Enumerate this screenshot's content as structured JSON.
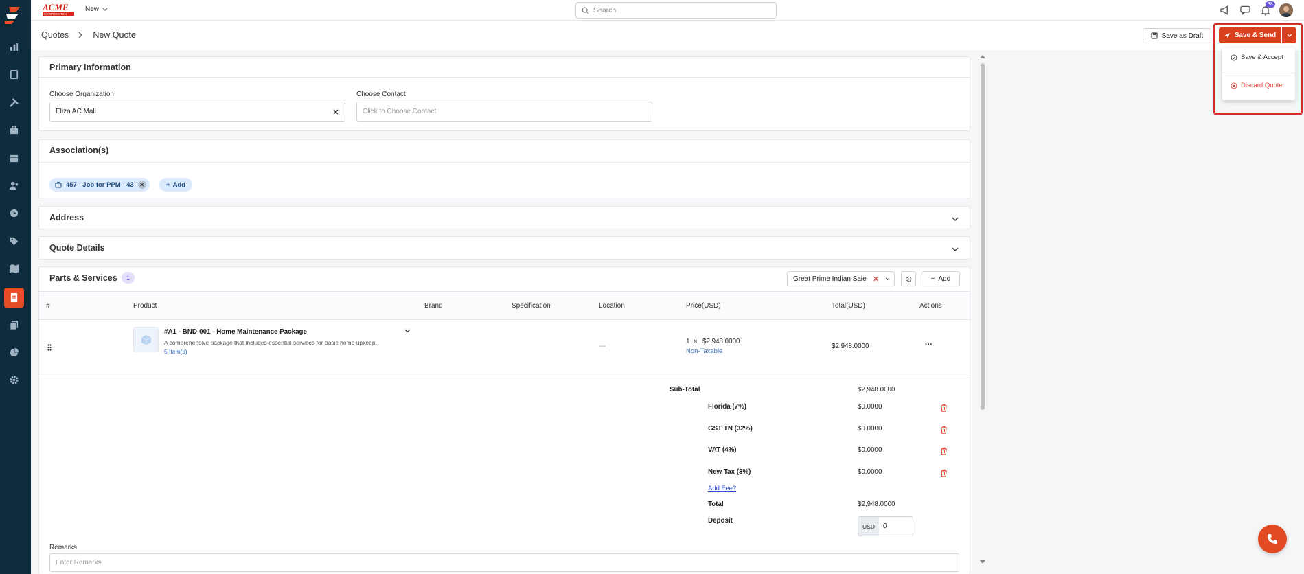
{
  "topbar": {
    "new_label": "New",
    "search_placeholder": "Search",
    "notif_count": "38"
  },
  "breadcrumb": {
    "root": "Quotes",
    "current": "New Quote"
  },
  "actions": {
    "save_draft": "Save as Draft",
    "save_send": "Save & Send",
    "save_accept": "Save & Accept",
    "discard": "Discard Quote"
  },
  "primary": {
    "title": "Primary Information",
    "org_label": "Choose Organization",
    "org_value": "Eliza AC Mall",
    "contact_label": "Choose Contact",
    "contact_placeholder": "Click to Choose Contact"
  },
  "associations": {
    "title": "Association(s)",
    "chip": "457 - Job for PPM - 43",
    "add": "Add"
  },
  "address": {
    "title": "Address"
  },
  "quote_details": {
    "title": "Quote Details"
  },
  "parts": {
    "title": "Parts & Services",
    "count": "1",
    "pricebook": "Great Prime Indian Sale",
    "add": "Add",
    "headers": {
      "num": "#",
      "product": "Product",
      "brand": "Brand",
      "spec": "Specification",
      "location": "Location",
      "price": "Price(USD)",
      "total": "Total(USD)",
      "actions": "Actions"
    },
    "row": {
      "name": "#A1 - BND-001 - Home Maintenance Package",
      "desc": "A comprehensive package that includes essential services for basic home upkeep.",
      "items": "5 Item(s)",
      "location": "---",
      "qty": "1",
      "times": "×",
      "price": "$2,948.0000",
      "tax": "Non-Taxable",
      "total": "$2,948.0000",
      "actions": "···"
    }
  },
  "summary": {
    "subtotal_label": "Sub-Total",
    "subtotal": "$2,948.0000",
    "taxes": [
      {
        "label": "Florida (7%)",
        "value": "$0.0000"
      },
      {
        "label": "GST TN (32%)",
        "value": "$0.0000"
      },
      {
        "label": "VAT (4%)",
        "value": "$0.0000"
      },
      {
        "label": "New Tax (3%)",
        "value": "$0.0000"
      }
    ],
    "add_fee": "Add Fee?",
    "total_label": "Total",
    "total": "$2,948.0000",
    "deposit_label": "Deposit",
    "deposit_currency": "USD",
    "deposit_value": "0"
  },
  "remarks": {
    "label": "Remarks",
    "placeholder": "Enter Remarks"
  },
  "colors": {
    "accent": "#d9411e",
    "sidebar": "#0f2c3f",
    "highlight": "#d72c2c"
  }
}
